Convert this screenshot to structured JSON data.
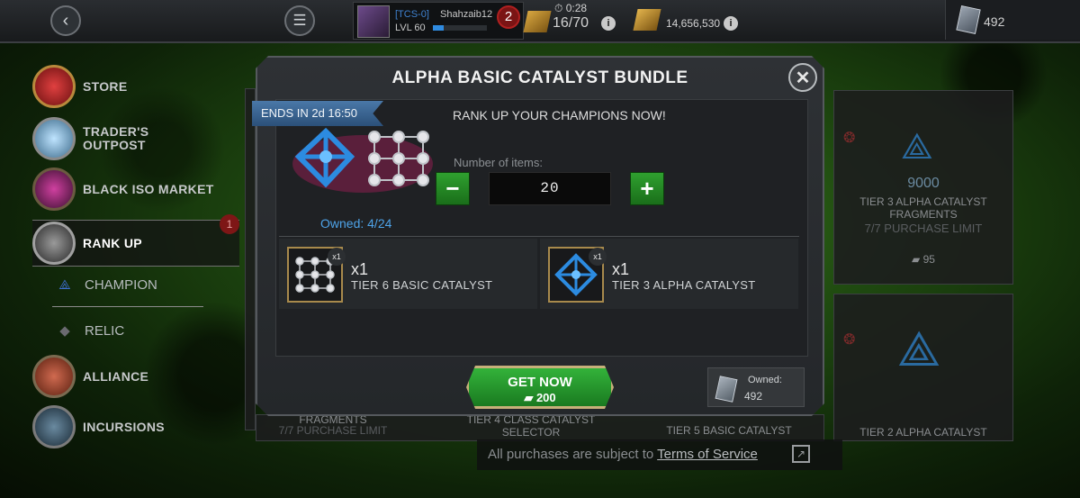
{
  "topbar": {
    "player_tag": "[TCS-0]",
    "player_name": "Shahzaib12",
    "level": "LVL 60",
    "level_progress": 0.2,
    "notification_count": "2",
    "energy_timer": "0:28",
    "energy": "16/70",
    "gold": "14,656,530",
    "units": "492"
  },
  "sidebar": {
    "items": [
      {
        "label": "STORE",
        "icon": "store-icon"
      },
      {
        "label": "TRADER'S OUTPOST",
        "icon": "traders-outpost-icon"
      },
      {
        "label": "BLACK ISO MARKET",
        "icon": "black-iso-icon"
      },
      {
        "label": "RANK UP",
        "icon": "rank-up-icon",
        "badge": "1"
      },
      {
        "label": "ALLIANCE",
        "icon": "alliance-icon"
      },
      {
        "label": "INCURSIONS",
        "icon": "incursions-icon"
      }
    ],
    "sub_items": [
      {
        "label": "CHAMPION",
        "icon": "champion-icon"
      },
      {
        "label": "RELIC",
        "icon": "relic-icon"
      }
    ]
  },
  "background_cards": {
    "card1": {
      "price": "9000",
      "name": "TIER 3 ALPHA CATALYST FRAGMENTS",
      "limit": "7/7 PURCHASE LIMIT",
      "cost": "95"
    },
    "card2": {
      "name": "TIER 2 ALPHA CATALYST"
    },
    "bottom_names": [
      "FRAGMENTS",
      "TIER 4 CLASS CATALYST SELECTOR",
      "TIER 5 BASIC CATALYST"
    ],
    "bottom_limit": "7/7 PURCHASE LIMIT"
  },
  "modal": {
    "title": "ALPHA BASIC CATALYST BUNDLE",
    "ends_in": "ENDS IN 2d 16:50",
    "owned": "Owned: 4/24",
    "headline": "RANK UP YOUR CHAMPIONS NOW!",
    "number_label": "Number of items:",
    "quantity": "20",
    "minus": "−",
    "plus": "+",
    "items": [
      {
        "badge": "x1",
        "qty": "x1",
        "name": "TIER 6 BASIC CATALYST"
      },
      {
        "badge": "x1",
        "qty": "x1",
        "name": "TIER 3 ALPHA CATALYST"
      }
    ],
    "button_label": "GET NOW",
    "price": "200",
    "owned_label": "Owned:",
    "owned_value": "492"
  },
  "footer": {
    "tos_prefix": "All purchases are subject to ",
    "tos_link": "Terms of Service"
  },
  "colors": {
    "accent_green": "#2fa02f",
    "accent_blue": "#4ea3e8",
    "badge_red": "#7e1616"
  }
}
